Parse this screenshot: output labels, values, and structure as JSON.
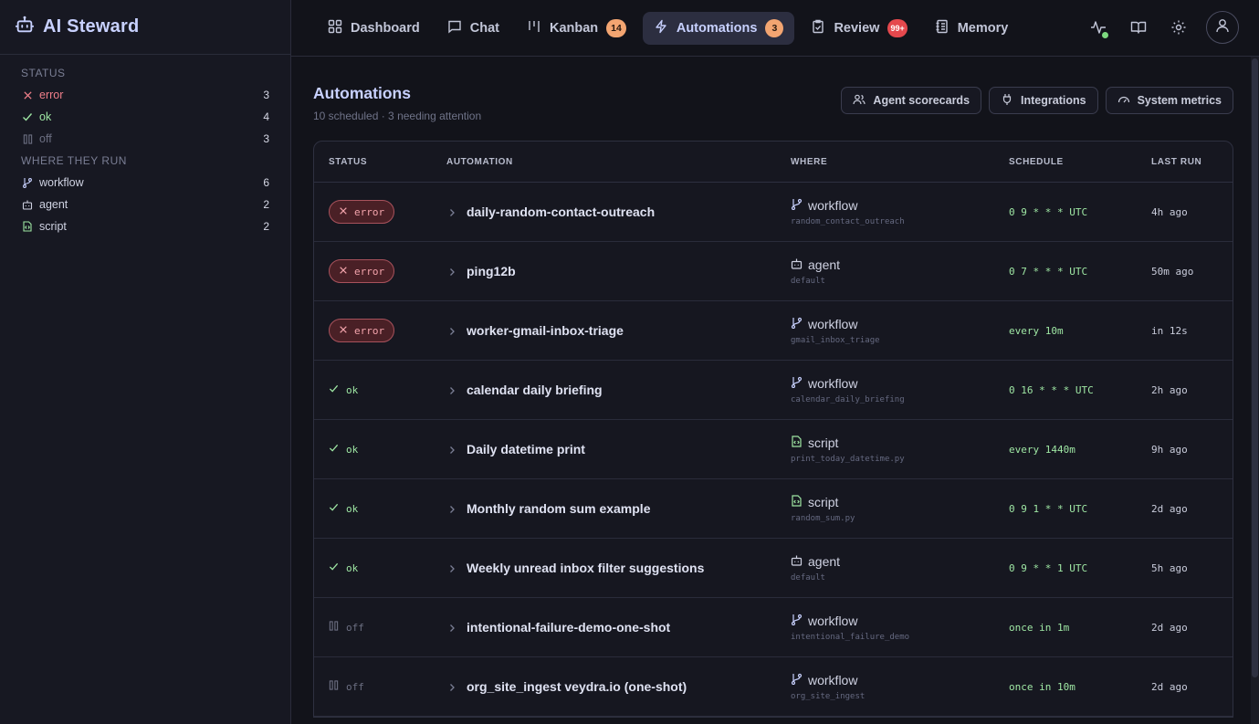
{
  "brand": {
    "title": "AI Steward",
    "icon": "robot-icon"
  },
  "sidebar": {
    "status_heading": "STATUS",
    "status_items": [
      {
        "label": "error",
        "count": "3",
        "icon": "x-icon"
      },
      {
        "label": "ok",
        "count": "4",
        "icon": "check-icon"
      },
      {
        "label": "off",
        "count": "3",
        "icon": "pause-icon"
      }
    ],
    "where_heading": "WHERE THEY RUN",
    "where_items": [
      {
        "label": "workflow",
        "count": "6",
        "icon": "git-branch-icon"
      },
      {
        "label": "agent",
        "count": "2",
        "icon": "robot-icon"
      },
      {
        "label": "script",
        "count": "2",
        "icon": "code-file-icon"
      }
    ]
  },
  "nav": {
    "tabs": [
      {
        "label": "Dashboard",
        "icon": "dashboard-grid-icon"
      },
      {
        "label": "Chat",
        "icon": "chat-bubble-icon"
      },
      {
        "label": "Kanban",
        "icon": "kanban-icon",
        "badge": "14"
      },
      {
        "label": "Automations",
        "icon": "bolt-icon",
        "badge": "3",
        "active": true
      },
      {
        "label": "Review",
        "icon": "clipboard-check-icon",
        "badge": "99+"
      },
      {
        "label": "Memory",
        "icon": "notebook-icon"
      }
    ],
    "right_icons": [
      "activity-icon",
      "book-open-icon",
      "gear-icon",
      "user-icon"
    ]
  },
  "page": {
    "title": "Automations",
    "subtitle": "10 scheduled · 3 needing attention",
    "actions": [
      {
        "label": "Agent scorecards",
        "icon": "users-icon"
      },
      {
        "label": "Integrations",
        "icon": "plug-icon"
      },
      {
        "label": "System metrics",
        "icon": "gauge-icon"
      }
    ]
  },
  "table": {
    "columns": [
      "STATUS",
      "AUTOMATION",
      "WHERE",
      "SCHEDULE",
      "LAST RUN"
    ],
    "rows": [
      {
        "status": "error",
        "name": "daily-random-contact-outreach",
        "where": "workflow",
        "where_sub": "random_contact_outreach",
        "schedule": "0 9 * * * UTC",
        "last_run": "4h ago"
      },
      {
        "status": "error",
        "name": "ping12b",
        "where": "agent",
        "where_sub": "default",
        "schedule": "0 7 * * * UTC",
        "last_run": "50m ago"
      },
      {
        "status": "error",
        "name": "worker-gmail-inbox-triage",
        "where": "workflow",
        "where_sub": "gmail_inbox_triage",
        "schedule": "every 10m",
        "last_run": "in 12s"
      },
      {
        "status": "ok",
        "name": "calendar daily briefing",
        "where": "workflow",
        "where_sub": "calendar_daily_briefing",
        "schedule": "0 16 * * * UTC",
        "last_run": "2h ago"
      },
      {
        "status": "ok",
        "name": "Daily datetime print",
        "where": "script",
        "where_sub": "print_today_datetime.py",
        "schedule": "every 1440m",
        "last_run": "9h ago"
      },
      {
        "status": "ok",
        "name": "Monthly random sum example",
        "where": "script",
        "where_sub": "random_sum.py",
        "schedule": "0 9 1 * * UTC",
        "last_run": "2d ago"
      },
      {
        "status": "ok",
        "name": "Weekly unread inbox filter suggestions",
        "where": "agent",
        "where_sub": "default",
        "schedule": "0 9 * * 1 UTC",
        "last_run": "5h ago"
      },
      {
        "status": "off",
        "name": "intentional-failure-demo-one-shot",
        "where": "workflow",
        "where_sub": "intentional_failure_demo",
        "schedule": "once in 1m",
        "last_run": "2d ago"
      },
      {
        "status": "off",
        "name": "org_site_ingest veydra.io (one-shot)",
        "where": "workflow",
        "where_sub": "org_site_ingest",
        "schedule": "once in 10m",
        "last_run": "2d ago"
      }
    ]
  },
  "colors": {
    "accent": "#c8d1ff",
    "error": "#f07f8a",
    "ok": "#9ee6a3",
    "badge_orange": "#f3a571",
    "badge_red": "#e5484d"
  }
}
